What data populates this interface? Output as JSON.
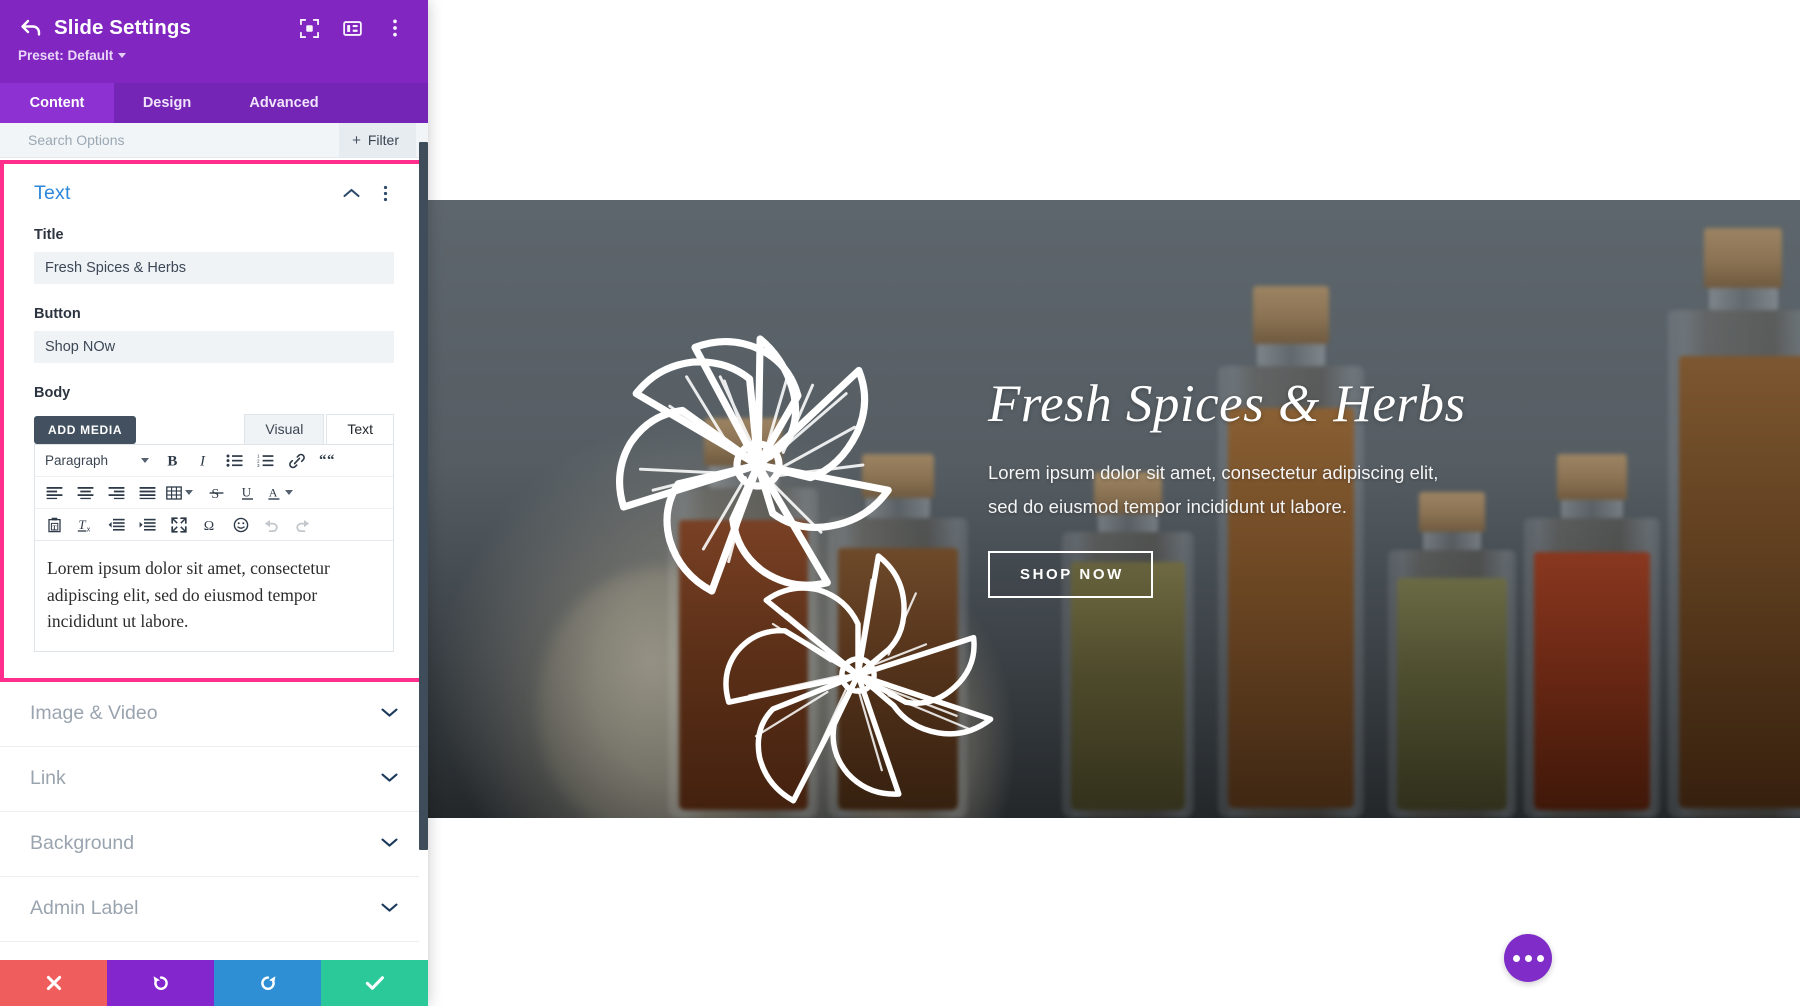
{
  "panel": {
    "header": {
      "title": "Slide Settings",
      "preset_label": "Preset: Default",
      "back_icon": "back-arrow-icon",
      "icons": [
        "target-focus-icon",
        "panel-layout-icon",
        "vertical-dots-icon"
      ]
    },
    "tabs": [
      {
        "label": "Content",
        "active": true
      },
      {
        "label": "Design",
        "active": false
      },
      {
        "label": "Advanced",
        "active": false
      }
    ],
    "search": {
      "placeholder": "Search Options",
      "value": "",
      "filter_label": "Filter",
      "filter_plus": "+"
    },
    "text_section": {
      "title": "Text",
      "expanded": true,
      "highlight_color": "#ff2d8c",
      "title_color": "#2b87da",
      "fields": {
        "title_label": "Title",
        "title_value": "Fresh Spices & Herbs",
        "button_label": "Button",
        "button_value": "Shop NOw",
        "body_label": "Body"
      },
      "editor": {
        "add_media_label": "ADD MEDIA",
        "tabs": [
          {
            "label": "Visual",
            "active": false
          },
          {
            "label": "Text",
            "active": true
          }
        ],
        "format_select": "Paragraph",
        "toolbar_row1": [
          "bold-icon",
          "italic-icon",
          "bulleted-list-icon",
          "numbered-list-icon",
          "link-icon",
          "blockquote-icon"
        ],
        "toolbar_row2": [
          "align-left-icon",
          "align-center-icon",
          "align-right-icon",
          "align-justify-icon",
          "table-icon",
          "strikethrough-icon",
          "underline-icon",
          "text-color-icon"
        ],
        "toolbar_row3": [
          "paste-as-text-icon",
          "clear-formatting-icon",
          "outdent-icon",
          "indent-icon",
          "fullscreen-icon",
          "special-character-icon",
          "emoji-icon",
          "undo-icon",
          "redo-icon"
        ],
        "body_value": "Lorem ipsum dolor sit amet, consectetur adipiscing elit, sed do eiusmod tempor incididunt ut labore."
      }
    },
    "collapsed_sections": [
      {
        "label": "Image & Video"
      },
      {
        "label": "Link"
      },
      {
        "label": "Background"
      },
      {
        "label": "Admin Label"
      }
    ],
    "action_bar": [
      {
        "name": "cancel",
        "icon": "close-x-icon",
        "color": "#f05d5d"
      },
      {
        "name": "undo",
        "icon": "undo-arrow-icon",
        "color": "#8326ce"
      },
      {
        "name": "redo",
        "icon": "redo-arrow-icon",
        "color": "#2f8fd4"
      },
      {
        "name": "save",
        "icon": "checkmark-icon",
        "color": "#2bc99a"
      }
    ]
  },
  "preview": {
    "slide": {
      "title": "Fresh Spices & Herbs",
      "body_line1": "Lorem ipsum dolor sit amet, consectetur adipiscing elit,",
      "body_line2": "sed do eiusmod tempor incididunt ut labore.",
      "button_label": "SHOP NOW",
      "dots": [
        {
          "active": true
        },
        {
          "active": false
        },
        {
          "active": false
        }
      ]
    },
    "fab": {
      "icon": "three-dots-icon",
      "color": "#7f2cc8"
    }
  }
}
